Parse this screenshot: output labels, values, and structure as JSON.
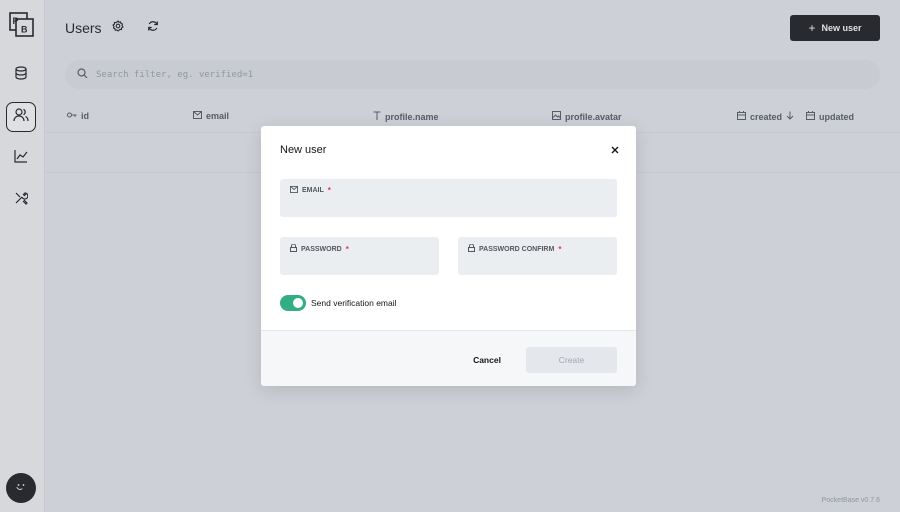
{
  "sidebar": {
    "logo_letters": [
      "P",
      "B"
    ],
    "items": [
      {
        "name": "collections",
        "icon": "database-icon"
      },
      {
        "name": "users",
        "icon": "users-icon",
        "active": true
      },
      {
        "name": "logs",
        "icon": "chart-line-icon"
      },
      {
        "name": "settings",
        "icon": "tools-icon"
      }
    ],
    "avatar_icon": "avatar-icon"
  },
  "header": {
    "title": "Users",
    "settings_icon": "gear-icon",
    "refresh_icon": "refresh-icon",
    "new_user_label": "New user",
    "new_user_icon": "plus-icon"
  },
  "search": {
    "placeholder": "Search filter, eg. verified=1",
    "icon": "search-icon"
  },
  "table": {
    "columns": [
      {
        "label": "id",
        "icon": "key-icon"
      },
      {
        "label": "email",
        "icon": "mail-icon"
      },
      {
        "label": "profile.name",
        "icon": "text-icon"
      },
      {
        "label": "profile.avatar",
        "icon": "image-icon"
      },
      {
        "label": "created",
        "icon": "calendar-icon",
        "sort": "desc"
      },
      {
        "label": "updated",
        "icon": "calendar-icon"
      }
    ]
  },
  "footer": {
    "version": "PocketBase v0.7.6"
  },
  "modal": {
    "title": "New user",
    "close_icon": "close-icon",
    "email": {
      "label": "EMAIL",
      "value": "",
      "required_mark": "*"
    },
    "password": {
      "label": "PASSWORD",
      "value": "",
      "required_mark": "*"
    },
    "password_confirm": {
      "label": "PASSWORD CONFIRM",
      "value": "",
      "required_mark": "*"
    },
    "verification_toggle": {
      "label": "Send verification email",
      "checked": true
    },
    "cancel_label": "Cancel",
    "create_label": "Create"
  },
  "colors": {
    "accent_dark": "#16161a",
    "toggle_on": "#32ad84",
    "required": "#e13756"
  }
}
